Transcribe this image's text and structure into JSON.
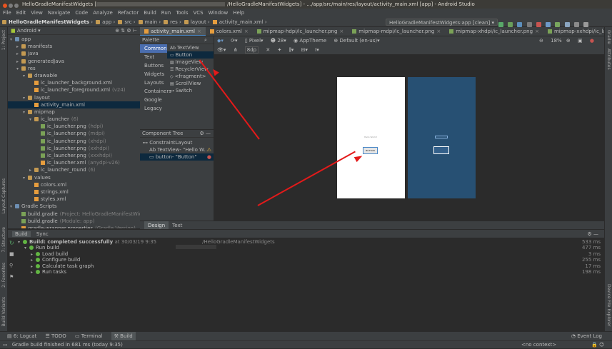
{
  "window": {
    "title_left": "HelloGradleManifestWidgets [",
    "title_right": "/HelloGradleManifestWidgets] - .../app/src/main/res/layout/activity_main.xml [app] - Android Studio"
  },
  "menu": [
    "File",
    "Edit",
    "View",
    "Navigate",
    "Code",
    "Analyze",
    "Refactor",
    "Build",
    "Run",
    "Tools",
    "VCS",
    "Window",
    "Help"
  ],
  "breadcrumbs": [
    "HelloGradleManifestWidgets",
    "app",
    "src",
    "main",
    "res",
    "layout",
    "activity_main.xml"
  ],
  "run_config": "HelloGradleManifestWidgets:app [clean]",
  "project_panel": {
    "view": "Android",
    "tree": [
      {
        "label": "app",
        "sub": "",
        "indent": 0,
        "arrow": "▾",
        "icon": "folder-b"
      },
      {
        "label": "manifests",
        "sub": "",
        "indent": 1,
        "arrow": "▸",
        "icon": "folder"
      },
      {
        "label": "java",
        "sub": "",
        "indent": 1,
        "arrow": "▸",
        "icon": "folder"
      },
      {
        "label": "generatedJava",
        "sub": "",
        "indent": 1,
        "arrow": "▸",
        "icon": "folder"
      },
      {
        "label": "res",
        "sub": "",
        "indent": 1,
        "arrow": "▾",
        "icon": "folder"
      },
      {
        "label": "drawable",
        "sub": "",
        "indent": 2,
        "arrow": "▾",
        "icon": "folder"
      },
      {
        "label": "ic_launcher_background.xml",
        "sub": "",
        "indent": 3,
        "arrow": "",
        "icon": "file-x"
      },
      {
        "label": "ic_launcher_foreground.xml",
        "sub": "(v24)",
        "indent": 3,
        "arrow": "",
        "icon": "file-x"
      },
      {
        "label": "layout",
        "sub": "",
        "indent": 2,
        "arrow": "▾",
        "icon": "folder"
      },
      {
        "label": "activity_main.xml",
        "sub": "",
        "indent": 3,
        "arrow": "",
        "icon": "file-x",
        "selected": true
      },
      {
        "label": "mipmap",
        "sub": "",
        "indent": 2,
        "arrow": "▾",
        "icon": "folder"
      },
      {
        "label": "ic_launcher",
        "sub": "(6)",
        "indent": 3,
        "arrow": "▾",
        "icon": "folder"
      },
      {
        "label": "ic_launcher.png",
        "sub": "(hdpi)",
        "indent": 4,
        "arrow": "",
        "icon": "file-p"
      },
      {
        "label": "ic_launcher.png",
        "sub": "(mdpi)",
        "indent": 4,
        "arrow": "",
        "icon": "file-p"
      },
      {
        "label": "ic_launcher.png",
        "sub": "(xhdpi)",
        "indent": 4,
        "arrow": "",
        "icon": "file-p"
      },
      {
        "label": "ic_launcher.png",
        "sub": "(xxhdpi)",
        "indent": 4,
        "arrow": "",
        "icon": "file-p"
      },
      {
        "label": "ic_launcher.png",
        "sub": "(xxxhdpi)",
        "indent": 4,
        "arrow": "",
        "icon": "file-p"
      },
      {
        "label": "ic_launcher.xml",
        "sub": "(anydpi-v26)",
        "indent": 4,
        "arrow": "",
        "icon": "file-x"
      },
      {
        "label": "ic_launcher_round",
        "sub": "(6)",
        "indent": 3,
        "arrow": "▸",
        "icon": "folder"
      },
      {
        "label": "values",
        "sub": "",
        "indent": 2,
        "arrow": "▾",
        "icon": "folder"
      },
      {
        "label": "colors.xml",
        "sub": "",
        "indent": 3,
        "arrow": "",
        "icon": "file-x"
      },
      {
        "label": "strings.xml",
        "sub": "",
        "indent": 3,
        "arrow": "",
        "icon": "file-x"
      },
      {
        "label": "styles.xml",
        "sub": "",
        "indent": 3,
        "arrow": "",
        "icon": "file-x"
      },
      {
        "label": "Gradle Scripts",
        "sub": "",
        "indent": 0,
        "arrow": "▾",
        "icon": "folder-b"
      },
      {
        "label": "build.gradle",
        "sub": "(Project: HelloGradleManifestWidgets)",
        "indent": 1,
        "arrow": "",
        "icon": "file-p"
      },
      {
        "label": "build.gradle",
        "sub": "(Module: app)",
        "indent": 1,
        "arrow": "",
        "icon": "file-p"
      },
      {
        "label": "gradle-wrapper.properties",
        "sub": "(Gradle Version)",
        "indent": 1,
        "arrow": "",
        "icon": "file-x"
      }
    ]
  },
  "editor_tabs": [
    {
      "label": "activity_main.xml",
      "active": true
    },
    {
      "label": "colors.xml",
      "active": false
    },
    {
      "label": "mipmap-hdpi/ic_launcher.png",
      "active": false
    },
    {
      "label": "mipmap-mdpi/ic_launcher.png",
      "active": false
    },
    {
      "label": "mipmap-xhdpi/ic_launcher.png",
      "active": false
    },
    {
      "label": "mipmap-xxhdpi/ic_launcher.png",
      "active": false
    }
  ],
  "palette": {
    "title": "Palette",
    "categories": [
      "Common",
      "Text",
      "Buttons",
      "Widgets",
      "Layouts",
      "Containers",
      "Google",
      "Legacy"
    ],
    "items": [
      "TextView",
      "Button",
      "ImageView",
      "RecyclerView",
      "<fragment>",
      "ScrollView",
      "Switch"
    ]
  },
  "component_tree": {
    "title": "Component Tree",
    "rows": [
      {
        "label": "ConstraintLayout",
        "indent": 0,
        "status": ""
      },
      {
        "label": "TextView- \"Hello W...",
        "indent": 1,
        "status": "warn"
      },
      {
        "label": "button- \"Button\"",
        "indent": 1,
        "status": "error",
        "selected": true
      }
    ]
  },
  "design_toolbar": {
    "dp": "8dp",
    "device": "Pixel",
    "api": "28",
    "theme": "AppTheme",
    "locale": "Default (en-us)",
    "zoom": "18%"
  },
  "preview": {
    "textview": "Hello World!",
    "button": "BUTTON"
  },
  "design_tabs": [
    "Design",
    "Text"
  ],
  "build": {
    "tabs": [
      "Build",
      "Sync"
    ],
    "rows": [
      {
        "label": "Build: completed successfully",
        "extra": " at 30/03/19 9:35",
        "path": "/HelloGradleManifestWidgets",
        "time": "533 ms",
        "indent": 0,
        "bold": true
      },
      {
        "label": "Run build",
        "extra": "",
        "path": "",
        "time": "477 ms",
        "indent": 1
      },
      {
        "label": "Load build",
        "extra": "",
        "path": "",
        "time": "3 ms",
        "indent": 2
      },
      {
        "label": "Configure build",
        "extra": "",
        "path": "",
        "time": "255 ms",
        "indent": 2
      },
      {
        "label": "Calculate task graph",
        "extra": "",
        "path": "",
        "time": "17 ms",
        "indent": 2
      },
      {
        "label": "Run tasks",
        "extra": "",
        "path": "",
        "time": "198 ms",
        "indent": 2
      }
    ]
  },
  "bottom_tools": [
    "6: Logcat",
    "TODO",
    "Terminal",
    "Build"
  ],
  "event_log": "Event Log",
  "status": {
    "message": "Gradle build finished in 681 ms (today 9:35)",
    "context": "<no context>"
  },
  "side_tools": {
    "left": [
      "1: Project",
      "Layout Captures",
      "7: Structure",
      "2: Favorites",
      "Build Variants"
    ],
    "right": [
      "Gradle",
      "Attributes",
      "Device File Explorer"
    ]
  }
}
